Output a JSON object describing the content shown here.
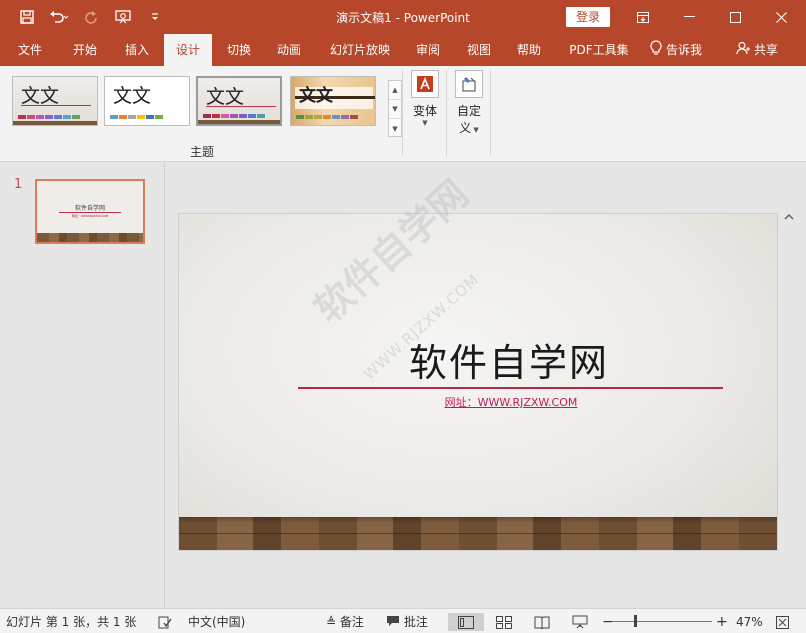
{
  "app": {
    "document_title": "演示文稿1",
    "app_name": "PowerPoint",
    "separator": "-",
    "login_label": "登录",
    "accent": "#b7472a"
  },
  "quick_access": {
    "icons": [
      "save-icon",
      "undo-icon",
      "redo-icon",
      "present-icon",
      "customize-icon"
    ]
  },
  "tabs": [
    {
      "label": "文件"
    },
    {
      "label": "开始"
    },
    {
      "label": "插入"
    },
    {
      "label": "设计",
      "active": true
    },
    {
      "label": "切换"
    },
    {
      "label": "动画"
    },
    {
      "label": "幻灯片放映"
    },
    {
      "label": "审阅"
    },
    {
      "label": "视图"
    },
    {
      "label": "帮助"
    },
    {
      "label": "PDF工具集"
    },
    {
      "label": "告诉我"
    },
    {
      "label": "共享"
    }
  ],
  "ribbon": {
    "themes": [
      {
        "text": "文文",
        "colors": [
          "#c0304a",
          "#d24b6c",
          "#c44fb8",
          "#8e5ed1",
          "#5b7cd9",
          "#5aa0c9",
          "#6aa05b"
        ]
      },
      {
        "text": "文文",
        "colors": [
          "#5b9bd5",
          "#ed7d31",
          "#a5a5a5",
          "#ffc000",
          "#4472c4",
          "#70ad47"
        ]
      },
      {
        "text": "文文",
        "colors": [
          "#a02b55",
          "#c0304a",
          "#d65a9a",
          "#9b59b6",
          "#7a5dc7",
          "#4f7fc2",
          "#4aa3a3"
        ]
      },
      {
        "text": "文文",
        "colors": [
          "#5a8c4a",
          "#8fae3c",
          "#c5a23b",
          "#d98c33",
          "#6d8fc2",
          "#8c6db0",
          "#b04a4a"
        ]
      }
    ],
    "group_label": "主题",
    "variants_label": "变体",
    "customize_label_1": "自定",
    "customize_label_2": "义"
  },
  "thumbnail": {
    "number": "1",
    "title": "软件自学网",
    "subtitle": "网址：WWW.RJZXW.COM"
  },
  "slide": {
    "title": "软件自学网",
    "subtitle": "网址：WWW.RJZXW.COM",
    "accent_line": "#b12a48"
  },
  "watermark": {
    "text": "软件自学网",
    "url": "WWW.RJZXW.COM"
  },
  "statusbar": {
    "slide_info": "幻灯片 第 1 张，共 1 张",
    "language": "中文(中国)",
    "notes_label": "备注",
    "comments_label": "批注",
    "zoom_level": "47%",
    "zoom_fraction": 0.47
  }
}
